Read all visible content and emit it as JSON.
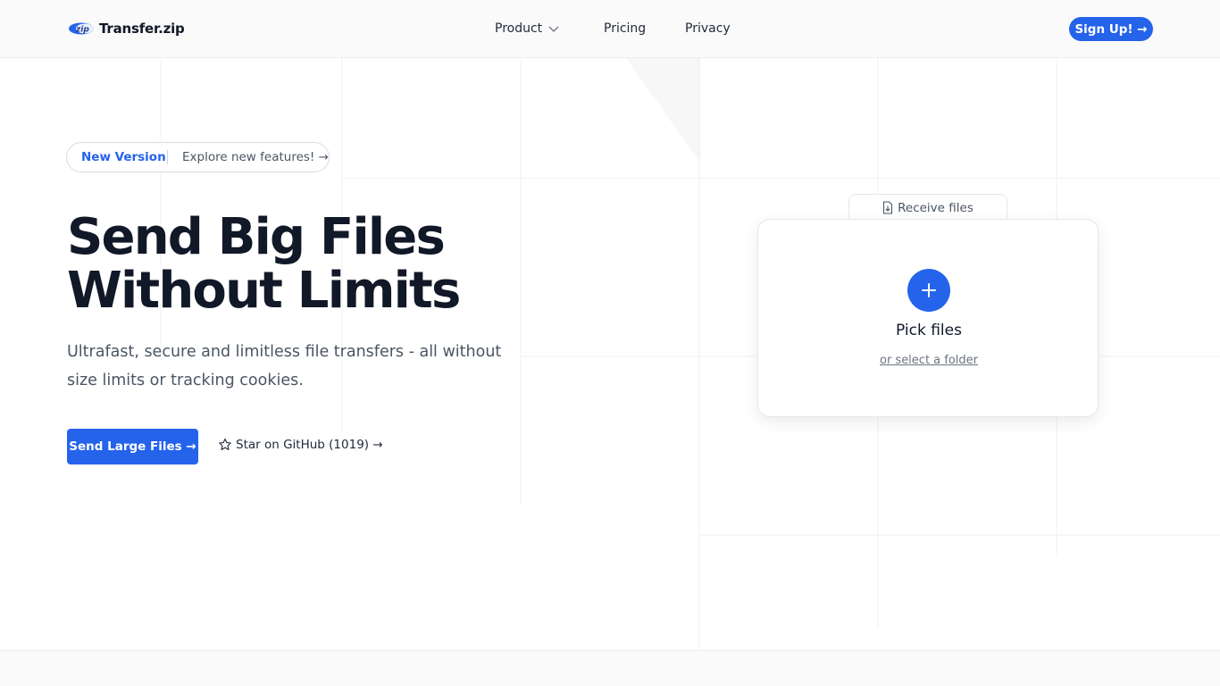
{
  "app": {
    "name": "Transfer.zip",
    "logo_badge": "zip",
    "accent_color": "#2563eb"
  },
  "nav": {
    "items": [
      {
        "label": "Product",
        "has_dropdown": true
      },
      {
        "label": "Pricing"
      },
      {
        "label": "Privacy"
      }
    ],
    "signup_label": "Sign Up! →"
  },
  "announcement": {
    "badge": "New Version",
    "link": "Explore new features! →"
  },
  "hero": {
    "title_line1": "Send Big Files",
    "title_line2": "Without Limits",
    "subtitle": "Ultrafast, secure and limitless file transfers - all without size limits or tracking cookies.",
    "primary_cta": "Send Large Files →",
    "github_cta": "Star on GitHub (1019) →"
  },
  "uploader": {
    "receive_tab": "Receive files",
    "pick_label": "Pick files",
    "folder_label": "or select a folder"
  }
}
